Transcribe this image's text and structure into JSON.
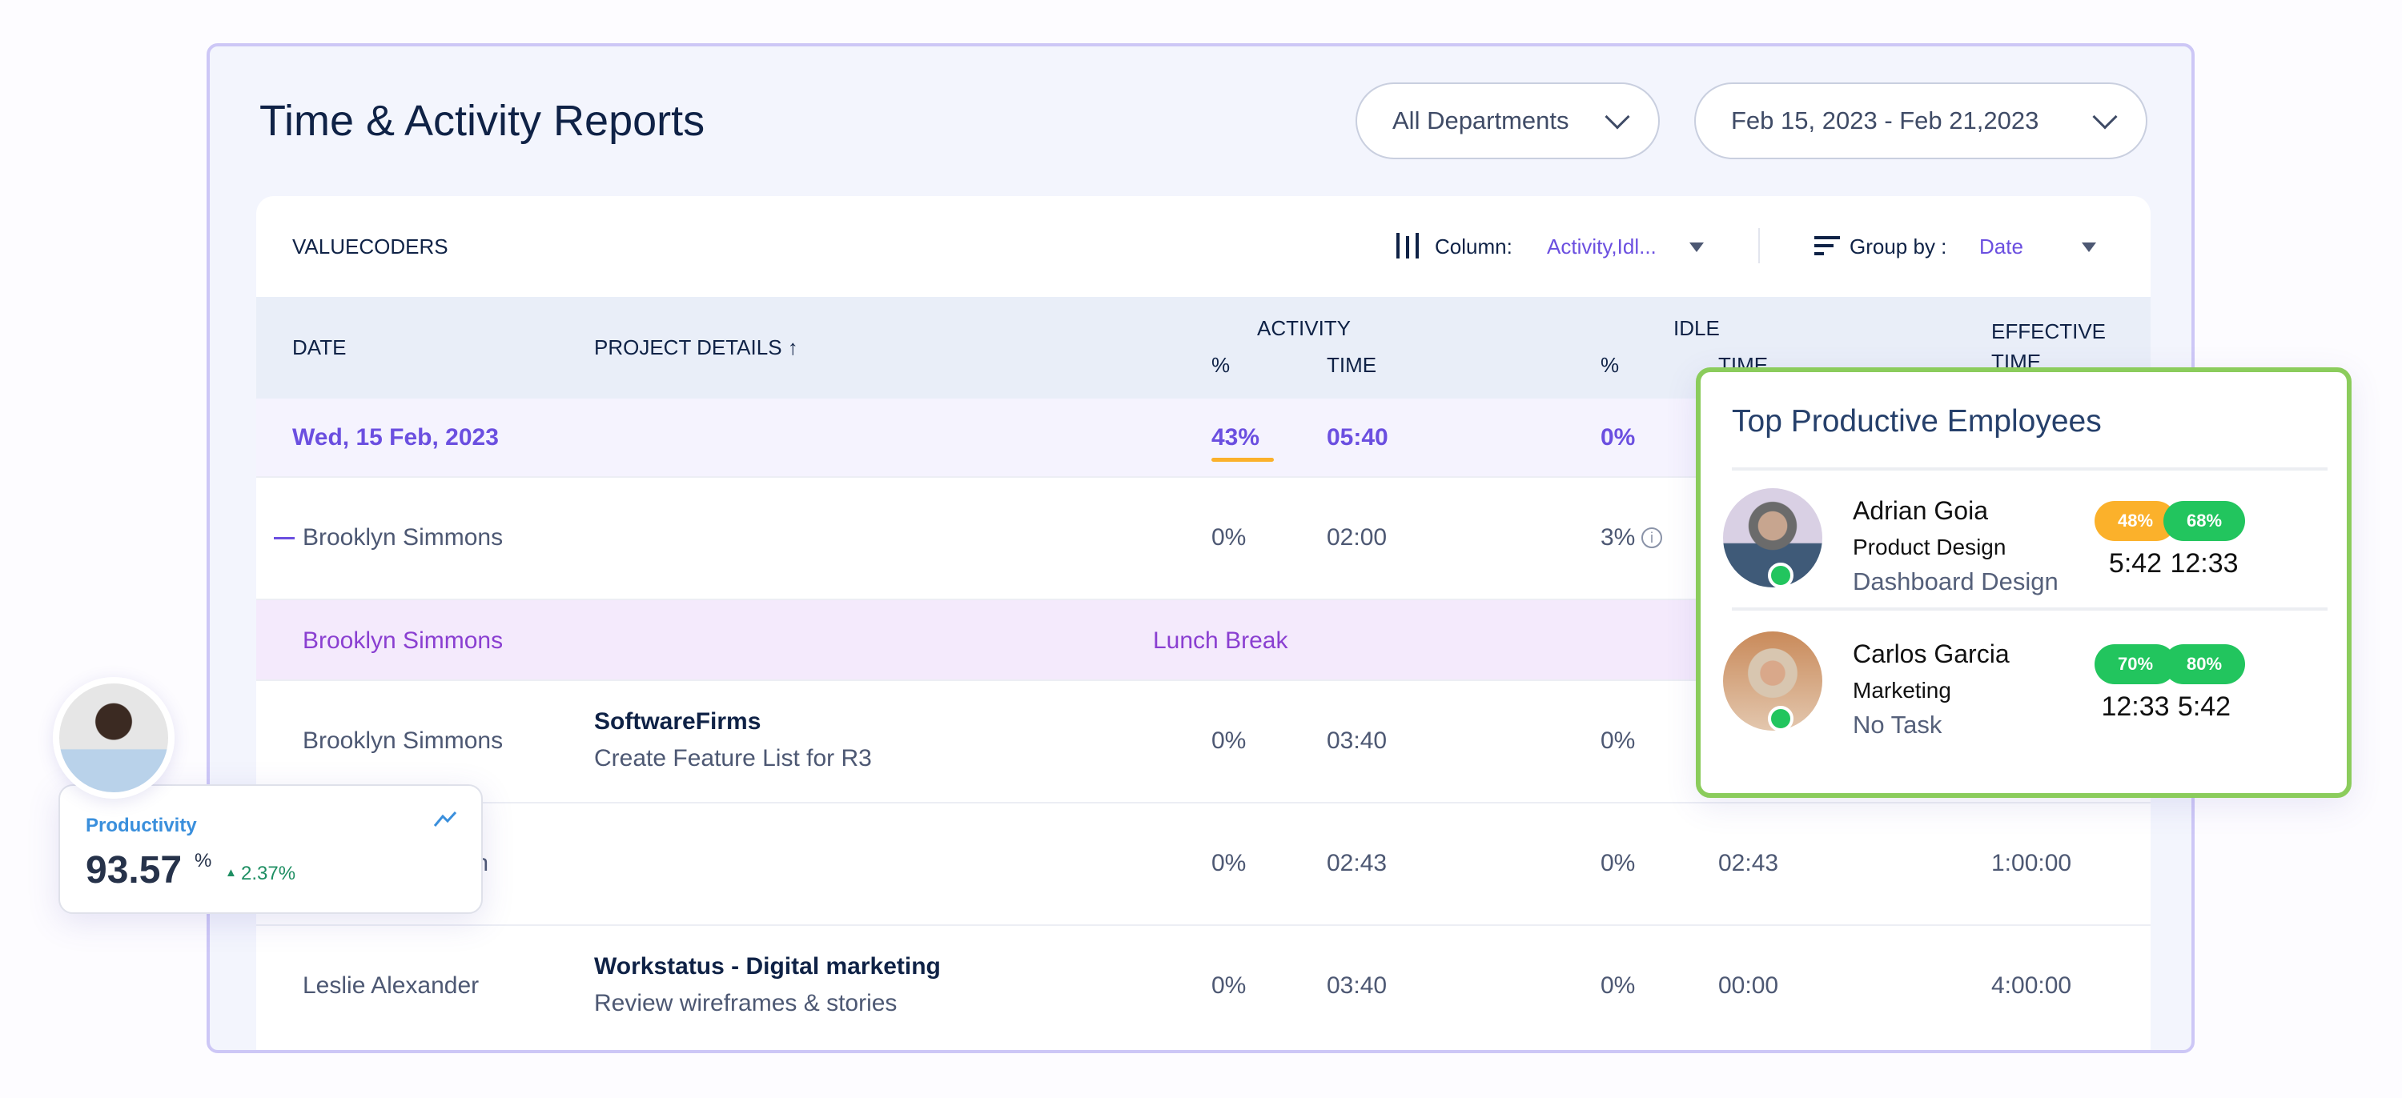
{
  "header": {
    "title": "Time & Activity Reports",
    "department": "All Departments",
    "date_range": "Feb 15, 2023 - Feb 21,2023"
  },
  "toolbar": {
    "company": "VALUECODERS",
    "column_label": "Column:",
    "column_value": "Activity,Idl...",
    "group_label": "Group by :",
    "group_value": "Date"
  },
  "columns": {
    "date": "DATE",
    "project": "PROJECT DETAILS ↑",
    "activity": "ACTIVITY",
    "idle": "IDLE",
    "effective": "EFFECTIVE",
    "effective2": "TIME",
    "pct": "%",
    "time": "TIME"
  },
  "group": {
    "date": "Wed, 15 Feb, 2023",
    "activity_pct": "43%",
    "activity_time": "05:40",
    "idle_pct": "0%"
  },
  "rows": [
    {
      "name": "Brooklyn Simmons",
      "act_pct": "0%",
      "act_time": "02:00",
      "idle_pct": "3%"
    },
    {
      "name": "Brooklyn Simmons",
      "project": "Lunch Break"
    },
    {
      "name": "Brooklyn Simmons",
      "project": "SoftwareFirms",
      "task": "Create Feature List for R3",
      "act_pct": "0%",
      "act_time": "03:40",
      "idle_pct": "0%"
    },
    {
      "name": "nson",
      "act_pct": "0%",
      "act_time": "02:43",
      "idle_pct": "0%",
      "idle_time": "02:43",
      "effective": "1:00:00"
    },
    {
      "name": "Leslie Alexander",
      "project": "Workstatus - Digital marketing",
      "task": "Review wireframes & stories",
      "act_pct": "0%",
      "act_time": "03:40",
      "idle_pct": "0%",
      "idle_time": "00:00",
      "effective": "4:00:00"
    }
  ],
  "top": {
    "title": "Top Productive Employees",
    "employees": [
      {
        "name": "Adrian Goia",
        "dept": "Product Design",
        "task": "Dashboard Design",
        "p1": "48%",
        "t1": "5:42",
        "p2": "68%",
        "t2": "12:33",
        "c1": "#fbb12b",
        "c2": "#22c55e"
      },
      {
        "name": "Carlos Garcia",
        "dept": "Marketing",
        "task": "No Task",
        "p1": "70%",
        "t1": "12:33",
        "p2": "80%",
        "t2": "5:42",
        "c1": "#22c55e",
        "c2": "#22c55e"
      }
    ]
  },
  "productivity": {
    "label": "Productivity",
    "value": "93.57",
    "unit": "%",
    "change": "2.37%"
  }
}
